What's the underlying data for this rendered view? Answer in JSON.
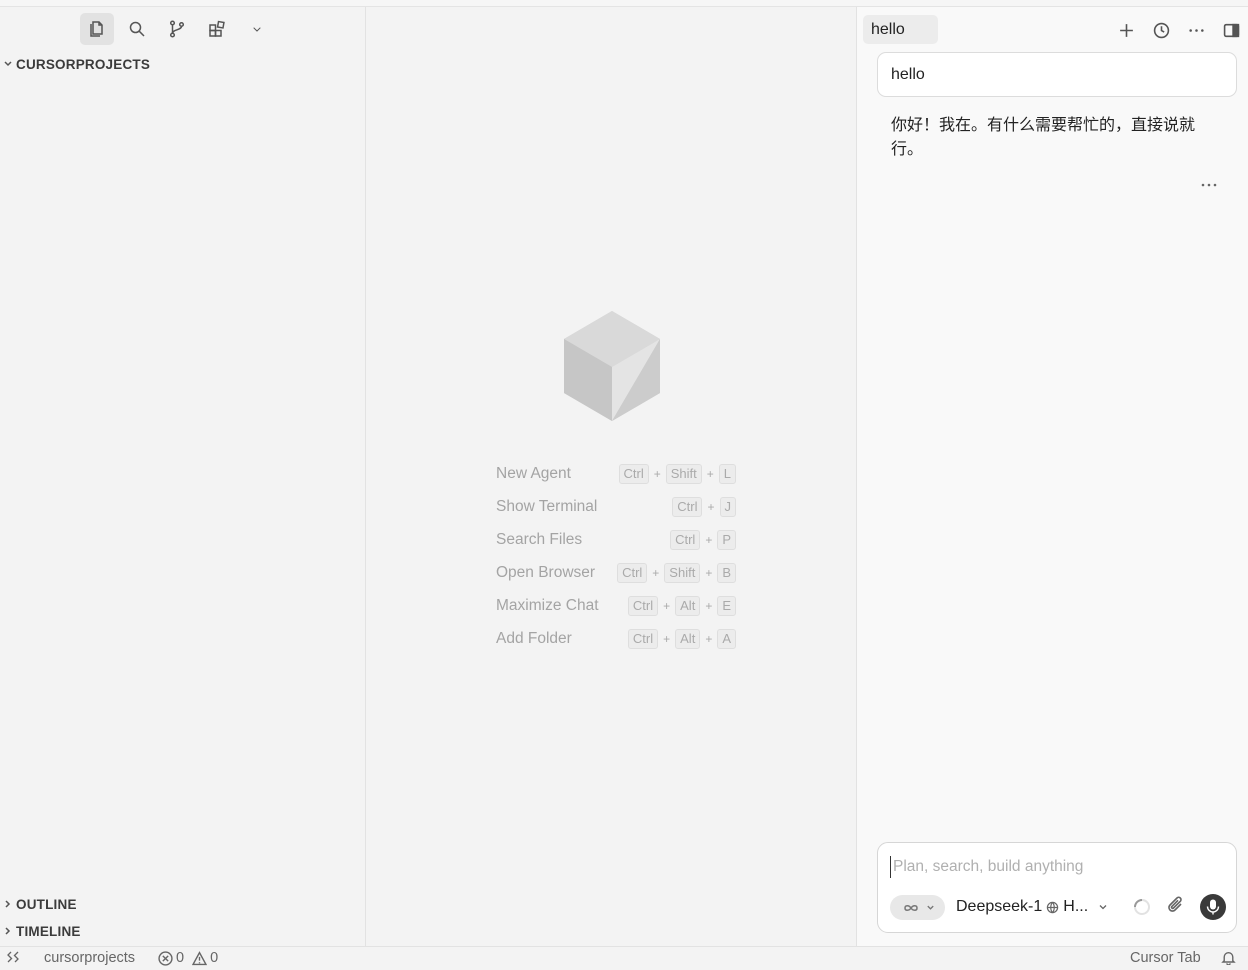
{
  "sidebar": {
    "activity_icons": [
      "files-icon",
      "search-icon",
      "source-control-icon",
      "extensions-icon",
      "chevron-down-icon"
    ],
    "explorer_title": "CURSORPROJECTS",
    "outline_title": "OUTLINE",
    "timeline_title": "TIMELINE"
  },
  "editor": {
    "shortcuts": [
      {
        "label": "New Agent",
        "keys": [
          "Ctrl",
          "Shift",
          "L"
        ]
      },
      {
        "label": "Show Terminal",
        "keys": [
          "Ctrl",
          "J"
        ]
      },
      {
        "label": "Search Files",
        "keys": [
          "Ctrl",
          "P"
        ]
      },
      {
        "label": "Open Browser",
        "keys": [
          "Ctrl",
          "Shift",
          "B"
        ]
      },
      {
        "label": "Maximize Chat",
        "keys": [
          "Ctrl",
          "Alt",
          "E"
        ]
      },
      {
        "label": "Add Folder",
        "keys": [
          "Ctrl",
          "Alt",
          "A"
        ]
      }
    ],
    "key_separator": "+"
  },
  "chat": {
    "tab_title": "hello",
    "tool_icons": [
      "plus-icon",
      "history-icon",
      "more-icon",
      "toggle-panel-icon"
    ],
    "user_message": "hello",
    "assistant_message": "你好！我在。有什么需要帮忙的，直接说就行。",
    "composer": {
      "placeholder": "Plan, search, build anything",
      "value": "",
      "mode_icon": "infinity-icon",
      "model_name": "Deepseek-1",
      "model_suffix": "H..."
    }
  },
  "statusbar": {
    "folder": "cursorprojects",
    "errors": "0",
    "warnings": "0",
    "right_label": "Cursor Tab"
  },
  "colors": {
    "background": "#f3f3f3",
    "chat_background": "#f9f9f9",
    "mic_button": "#3a3a3a"
  }
}
